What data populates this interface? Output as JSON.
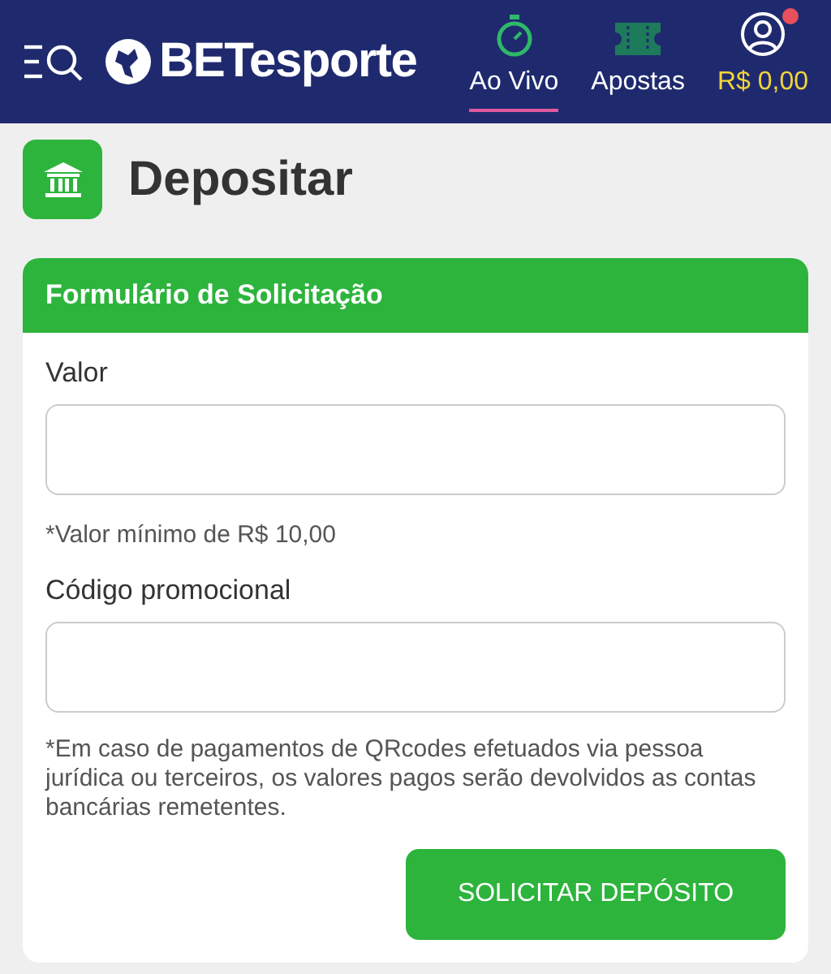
{
  "header": {
    "logo": "BETesporte",
    "nav": [
      {
        "label": "Ao Vivo",
        "kind": "live",
        "selected": true
      },
      {
        "label": "Apostas",
        "kind": "bets",
        "selected": false
      }
    ],
    "account": {
      "balance": "R$ 0,00",
      "notification": true
    }
  },
  "page": {
    "title": "Depositar"
  },
  "form": {
    "title": "Formulário de Solicitação",
    "fields": [
      {
        "label": "Valor",
        "hint": "*Valor mínimo de R$ 10,00"
      },
      {
        "label": "Código promocional"
      }
    ],
    "notice": "*Em caso de pagamentos de QRcodes efetuados via pessoa jurídica ou terceiros, os valores pagos serão devolvidos as contas bancárias remetentes.",
    "submit": "SOLICITAR DEPÓSITO"
  }
}
